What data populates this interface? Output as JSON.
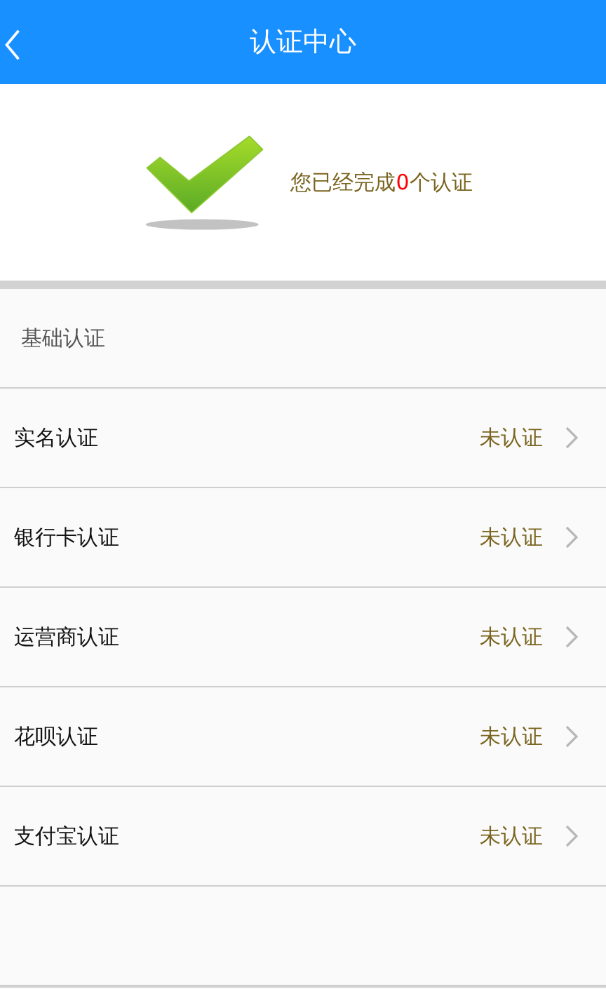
{
  "header": {
    "title": "认证中心"
  },
  "summary": {
    "before": "您已经完成",
    "count": "0",
    "after": "个认证"
  },
  "section": {
    "title": "基础认证"
  },
  "items": [
    {
      "label": "实名认证",
      "status": "未认证"
    },
    {
      "label": "银行卡认证",
      "status": "未认证"
    },
    {
      "label": "运营商认证",
      "status": "未认证"
    },
    {
      "label": "花呗认证",
      "status": "未认证"
    },
    {
      "label": "支付宝认证",
      "status": "未认证"
    }
  ]
}
